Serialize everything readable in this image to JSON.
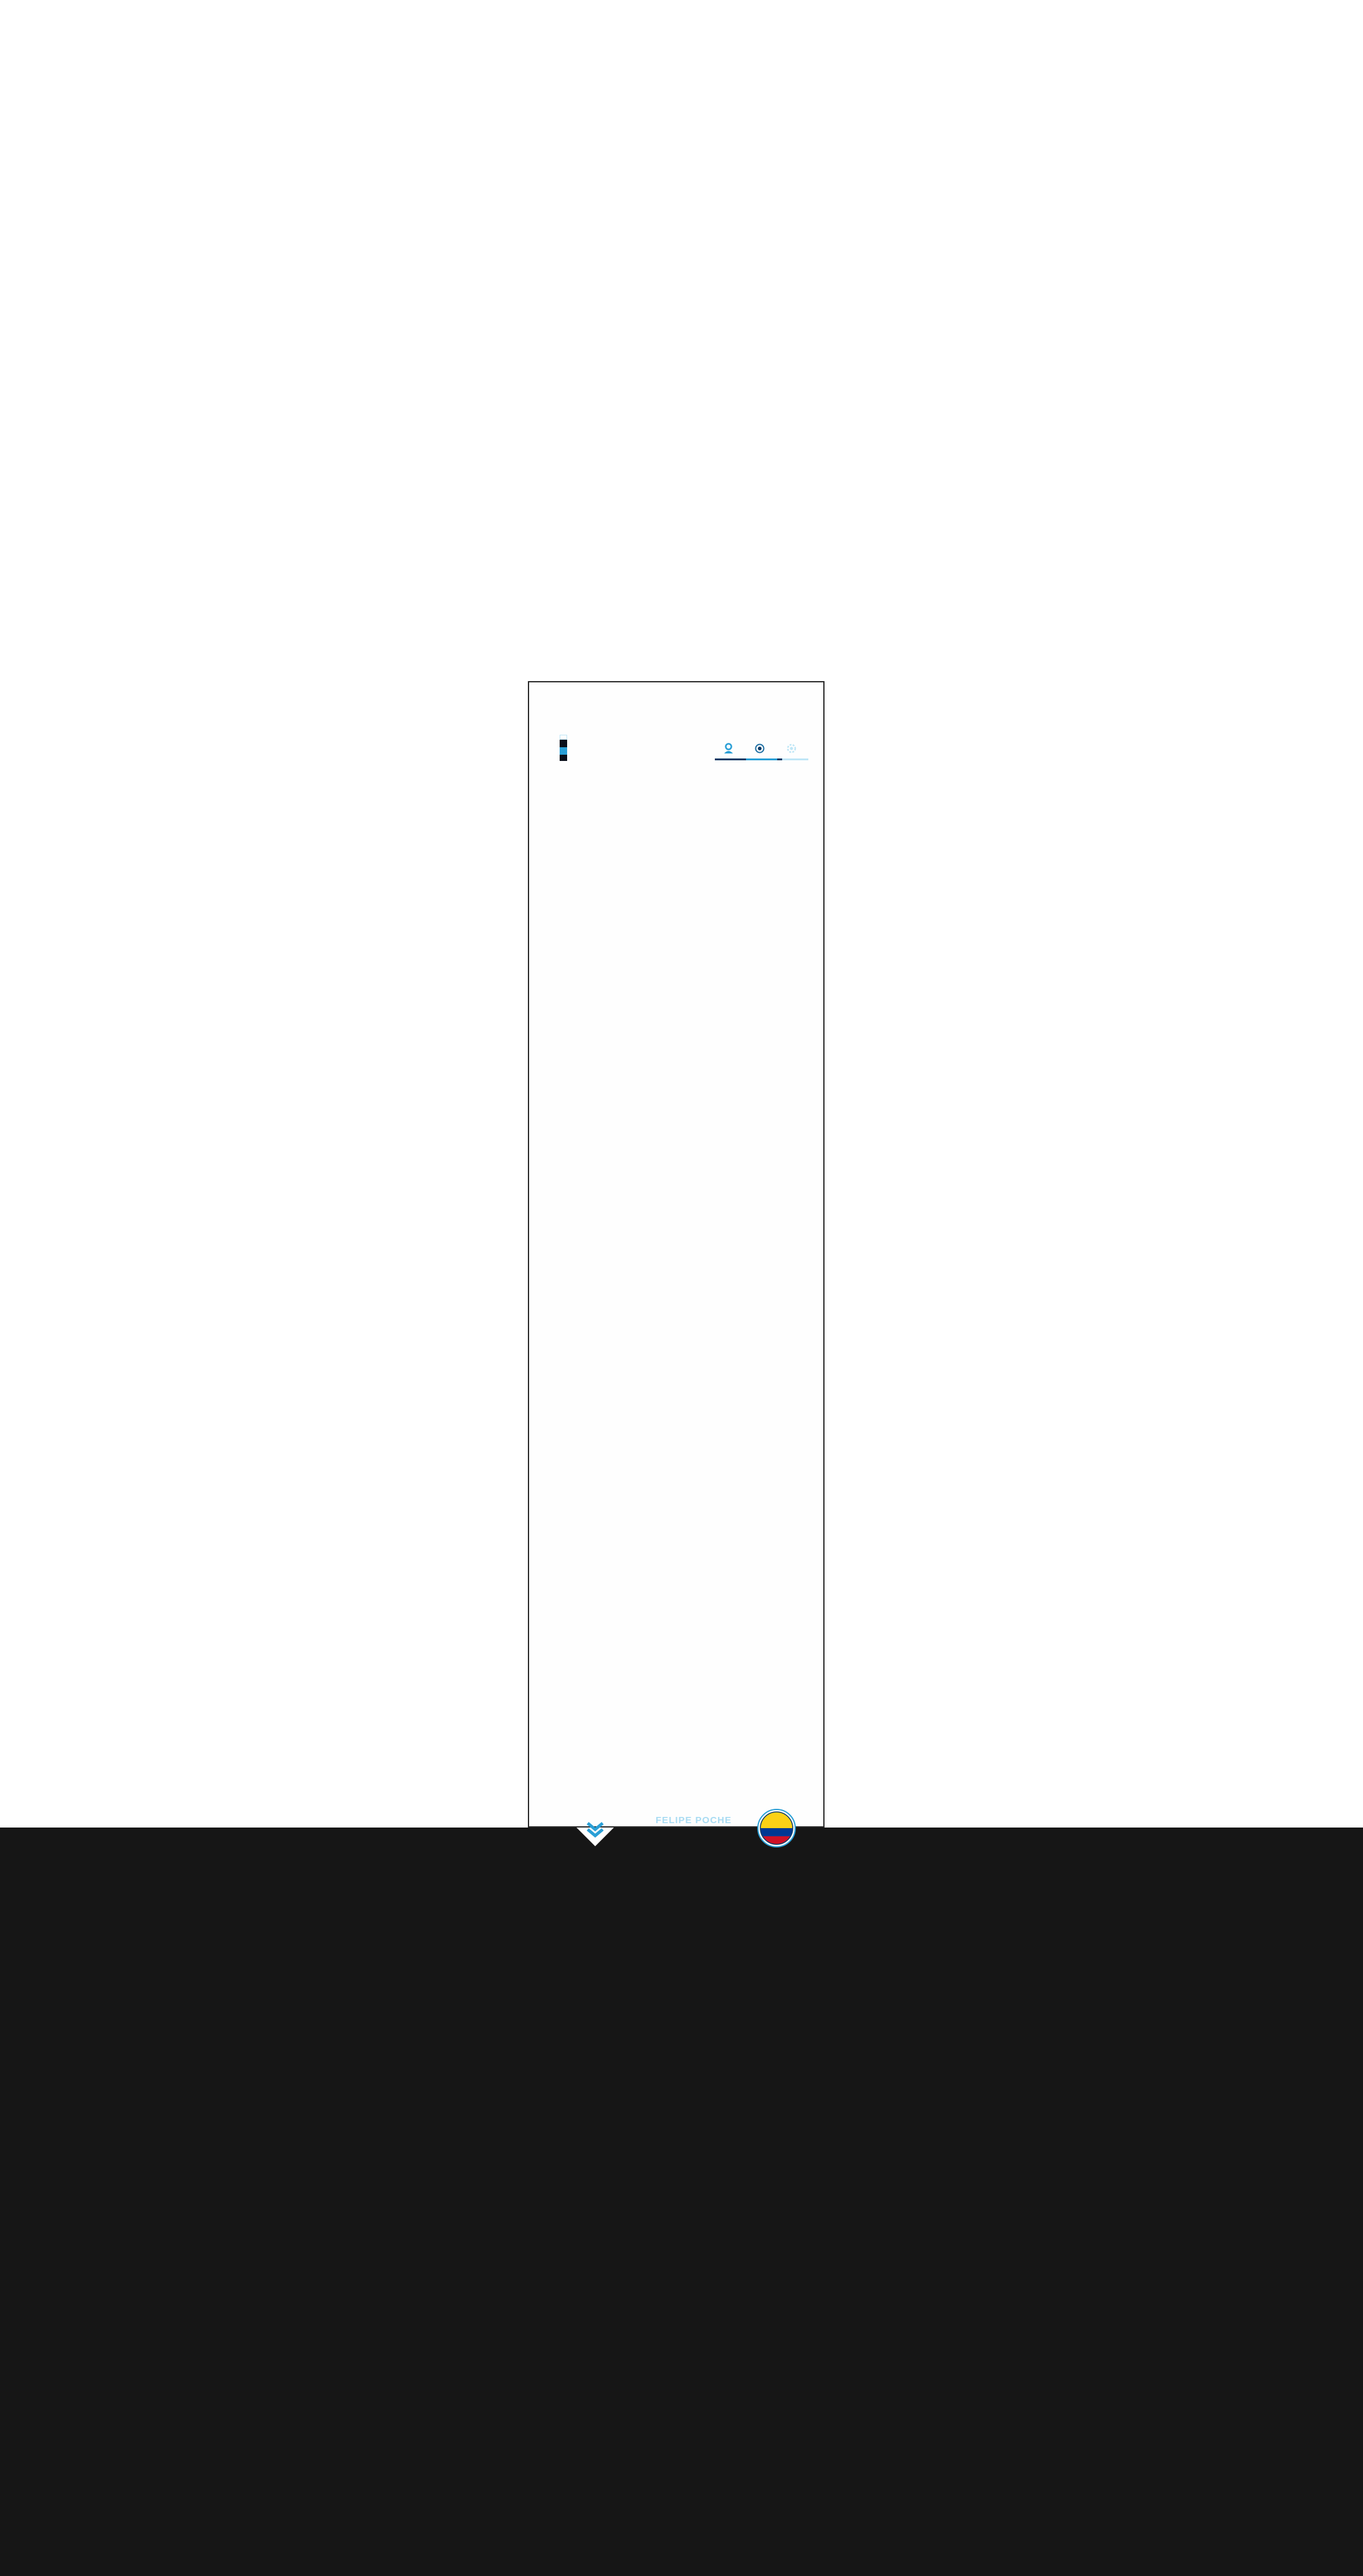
{
  "brand": {
    "name": "FELIPE POCHE"
  },
  "palette": {
    "accent": "#2a9fd6",
    "accent_dark": "#0d3b66",
    "accent_light": "#bfe6f6",
    "footer_bg": "#161616",
    "frame_border": "#2a2a2a"
  },
  "swatches": [
    "#bfe6f6",
    "#0a0f1a",
    "#2a9fd6",
    "#0a0f1a"
  ],
  "nav": {
    "items": [
      {
        "icon": "user-icon",
        "color": "#2a9fd6",
        "active": true
      },
      {
        "icon": "target-icon",
        "color": "#1f6fa3",
        "active": false
      },
      {
        "icon": "gear-icon",
        "color": "#bfe6f6",
        "active": false
      }
    ]
  },
  "scroll": {
    "icon": "double-chevron-down-icon"
  },
  "badge": {
    "icon": "colombia-flag-icon",
    "flag_colors": [
      "#fcd116",
      "#003893",
      "#ce1126"
    ]
  }
}
